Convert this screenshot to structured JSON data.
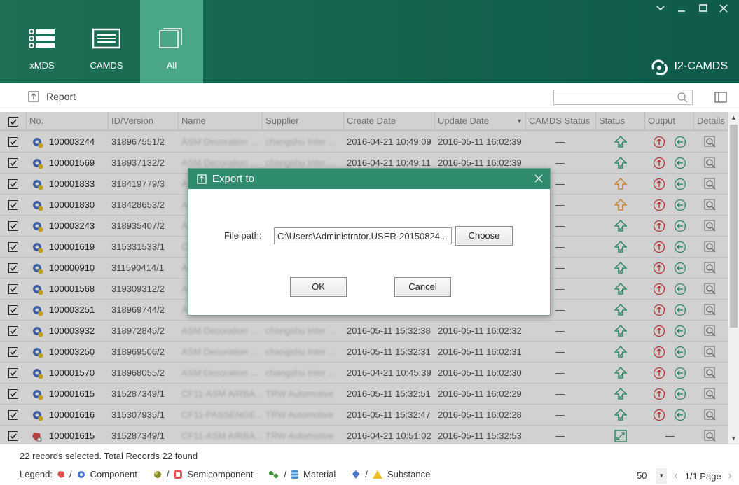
{
  "window": {
    "minimize_label": "—",
    "maximize_label": "☐",
    "close_label": "✕",
    "collapse_label": "⌄"
  },
  "nav": {
    "items": [
      {
        "label": "xMDS",
        "icon": "list-icon"
      },
      {
        "label": "CAMDS",
        "icon": "form-icon"
      },
      {
        "label": "All",
        "icon": "stack-icon",
        "active": true
      }
    ]
  },
  "brand": {
    "name": "I2-CAMDS"
  },
  "toolbar": {
    "report_label": "Report",
    "search_placeholder": ""
  },
  "table": {
    "headers": [
      "No.",
      "ID/Version",
      "Name",
      "Supplier",
      "Create Date",
      "Update Date",
      "CAMDS Status",
      "Status",
      "Output",
      "Details"
    ],
    "rows": [
      {
        "no": "100003244",
        "id": "318967551/2",
        "name": "ASM Decoration ...",
        "supplier": "changshu Inter ...",
        "create": "2016-04-21 10:49:09",
        "update": "2016-05-11 16:02:39",
        "camds": "—",
        "status": "green-up"
      },
      {
        "no": "100001569",
        "id": "318937132/2",
        "name": "ASM Decoration ...",
        "supplier": "changshu Inter ...",
        "create": "2016-04-21 10:49:11",
        "update": "2016-05-11 16:02:39",
        "camds": "—",
        "status": "green-up"
      },
      {
        "no": "100001833",
        "id": "318419779/3",
        "name": "A",
        "supplier": "",
        "create": "",
        "update": "",
        "camds": "—",
        "status": "orange-up"
      },
      {
        "no": "100001830",
        "id": "318428653/2",
        "name": "A",
        "supplier": "",
        "create": "",
        "update": "",
        "camds": "—",
        "status": "orange-up"
      },
      {
        "no": "100003243",
        "id": "318935407/2",
        "name": "A",
        "supplier": "",
        "create": "",
        "update": "",
        "camds": "—",
        "status": "green-up"
      },
      {
        "no": "100001619",
        "id": "315331533/1",
        "name": "C",
        "supplier": "",
        "create": "",
        "update": "",
        "camds": "—",
        "status": "green-up"
      },
      {
        "no": "100000910",
        "id": "311590414/1",
        "name": "A",
        "supplier": "",
        "create": "",
        "update": "",
        "camds": "—",
        "status": "green-up"
      },
      {
        "no": "100001568",
        "id": "319309312/2",
        "name": "A",
        "supplier": "",
        "create": "",
        "update": "",
        "camds": "—",
        "status": "green-up"
      },
      {
        "no": "100003251",
        "id": "318969744/2",
        "name": "A",
        "supplier": "",
        "create": "",
        "update": "",
        "camds": "—",
        "status": "green-up"
      },
      {
        "no": "100003932",
        "id": "318972845/2",
        "name": "ASM Decoration ...",
        "supplier": "changshu Inter ...",
        "create": "2016-05-11 15:32:38",
        "update": "2016-05-11 16:02:32",
        "camds": "—",
        "status": "green-up"
      },
      {
        "no": "100003250",
        "id": "318969506/2",
        "name": "ASM Decoration ...",
        "supplier": "changshu Inter ...",
        "create": "2016-05-11 15:32:31",
        "update": "2016-05-11 16:02:31",
        "camds": "—",
        "status": "green-up"
      },
      {
        "no": "100001570",
        "id": "318968055/2",
        "name": "ASM Decoration ...",
        "supplier": "changshu Inter ...",
        "create": "2016-04-21 10:45:39",
        "update": "2016-05-11 16:02:30",
        "camds": "—",
        "status": "green-up"
      },
      {
        "no": "100001615",
        "id": "315287349/1",
        "name": "CF11-ASM AIRBA...",
        "supplier": "TRW Automotive",
        "create": "2016-05-11 15:32:51",
        "update": "2016-05-11 16:02:29",
        "camds": "—",
        "status": "green-up"
      },
      {
        "no": "100001616",
        "id": "315307935/1",
        "name": "CF11-PASSENGE...",
        "supplier": "TRW Automotive",
        "create": "2016-05-11 15:32:47",
        "update": "2016-05-11 16:02:28",
        "camds": "—",
        "status": "green-up"
      },
      {
        "no": "100001615",
        "id": "315287349/1",
        "name": "CF11-ASM AIRBA...",
        "supplier": "TRW Automotive",
        "create": "2016-04-21 10:51:02",
        "update": "2016-05-11 15:32:53",
        "camds": "—",
        "status": "green-expand",
        "output_blank": "—"
      }
    ]
  },
  "footer": {
    "status_text": "22 records selected. Total Records 22 found",
    "legend_label": "Legend:",
    "legend_items": [
      "Component",
      "Semicomponent",
      "Material",
      "Substance"
    ],
    "legend_sep": "/",
    "page_size": "50",
    "page_info": "1/1 Page"
  },
  "dialog": {
    "title": "Export to",
    "file_path_label": "File path:",
    "file_path_value": "C:\\Users\\Administrator.USER-20150824...",
    "choose_label": "Choose",
    "ok_label": "OK",
    "cancel_label": "Cancel"
  },
  "colors": {
    "header_bg": "#1a6a53",
    "nav_active": "#4aa888",
    "dialog_title": "#2f8b6e",
    "status_green": "#3aa57a",
    "status_orange": "#f0a13c",
    "output_red": "#d94040",
    "output_green": "#3aa57a"
  }
}
